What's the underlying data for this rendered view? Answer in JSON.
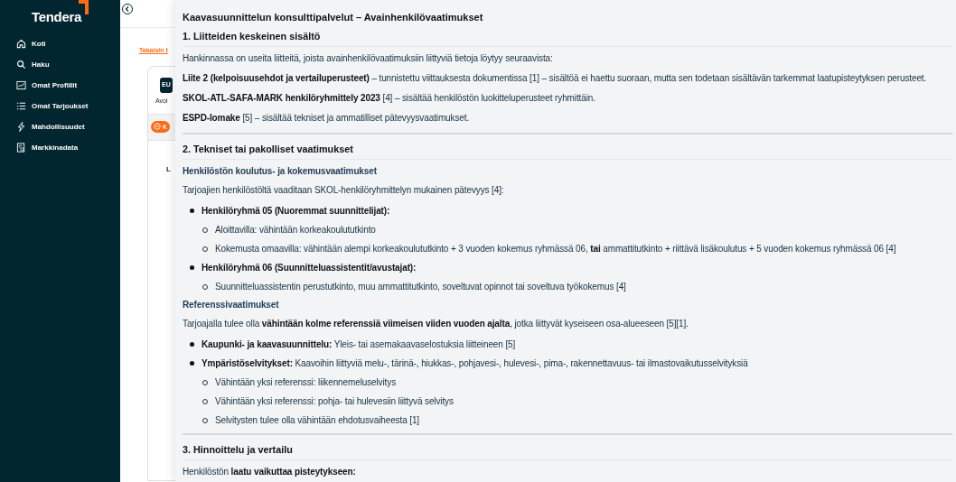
{
  "sidebar": {
    "logo": "Tendera",
    "items": [
      {
        "label": "Koti"
      },
      {
        "label": "Haku"
      },
      {
        "label": "Omat Profiilit"
      },
      {
        "label": "Omat Tarjoukset"
      },
      {
        "label": "Mahdollisuudet"
      },
      {
        "label": "Markkinadata"
      }
    ]
  },
  "background": {
    "back_link": "Takaisin t",
    "badge": "EU",
    "status": "Avoi",
    "button": "K",
    "heading": "L"
  },
  "panel": {
    "title": "Kaavasuunnittelun konsulttipalvelut – Avainhenkilövaatimukset",
    "sections": [
      {
        "heading": "1. Liitteiden keskeinen sisältö",
        "blocks": [
          {
            "kind": "p",
            "text": "Hankinnassa on useita liitteitä, joista avainhenkilövaatimuksiin liittyviä tietoja löytyy seuraavista:"
          },
          {
            "kind": "p",
            "text": "**Liite 2 (kelpoisuusehdot ja vertailuperusteet)** – tunnistettu viittauksesta dokumentissa [1] – sisältöä ei haettu suoraan, mutta sen todetaan sisältävän tarkemmat laatupisteytyksen perusteet."
          },
          {
            "kind": "p",
            "text": "**SKOL-ATL-SAFA-MARK henkilöryhmittely 2023** [4] – sisältää henkilöstön luokitteluperusteet ryhmittäin."
          },
          {
            "kind": "p",
            "text": "**ESPD-lomake** [5] – sisältää tekniset ja ammatilliset pätevyysvaatimukset."
          }
        ]
      },
      {
        "heading": "2. Tekniset tai pakolliset vaatimukset",
        "blocks": [
          {
            "kind": "subheading",
            "text": "Henkilöstön koulutus- ja kokemusvaatimukset"
          },
          {
            "kind": "p",
            "text": "Tarjoajien henkilöstöltä vaaditaan SKOL-henkilöryhmittelyn mukainen pätevyys [4]:"
          },
          {
            "kind": "list",
            "items": [
              {
                "text": "**Henkilöryhmä 05 (Nuoremmat suunnittelijat):**",
                "children": [
                  {
                    "text": "Aloittavilla: vähintään korkeakoulututkinto"
                  },
                  {
                    "text": "Kokemusta omaavilla: vähintään alempi korkeakoulututkinto + 3 vuoden kokemus ryhmässä 06, **tai** ammattitutkinto + riittävä lisäkoulutus + 5 vuoden kokemus ryhmässä 06 [4]"
                  }
                ]
              },
              {
                "text": "**Henkilöryhmä 06 (Suunnitteluassistentit/avustajat):**",
                "children": [
                  {
                    "text": "Suunnitteluassistentin perustutkinto, muu ammattitutkinto, soveltuvat opinnot tai soveltuva työkokemus [4]"
                  }
                ]
              }
            ]
          },
          {
            "kind": "subheading",
            "text": "Referenssivaatimukset"
          },
          {
            "kind": "p",
            "text": "Tarjoajalla tulee olla **vähintään kolme referenssiä viimeisen viiden vuoden ajalta**, jotka liittyvät kyseiseen osa-alueeseen [5][1]."
          },
          {
            "kind": "list",
            "items": [
              {
                "text": "**Kaupunki- ja kaavasuunnittelu:** Yleis- tai asemakaavaselostuksia liitteineen [5]"
              },
              {
                "text": "**Ympäristöselvitykset:** Kaavoihin liittyviä melu-, tärinä-, hiukkas-, pohjavesi-, hulevesi-, pima-, rakennettavuus- tai ilmastovaikutusselvityksiä",
                "children": [
                  {
                    "text": "Vähintään yksi referenssi: liikennemeluselvitys"
                  },
                  {
                    "text": "Vähintään yksi referenssi: pohja- tai hulevesiin liittyvä selvitys"
                  },
                  {
                    "text": "Selvitysten tulee olla vähintään ehdotusvaiheesta [1]"
                  }
                ]
              }
            ]
          }
        ]
      },
      {
        "heading": "3. Hinnoittelu ja vertailu",
        "blocks": [
          {
            "kind": "p",
            "text": "Henkilöstön **laatu vaikuttaa pisteytykseen:**"
          }
        ]
      }
    ]
  }
}
